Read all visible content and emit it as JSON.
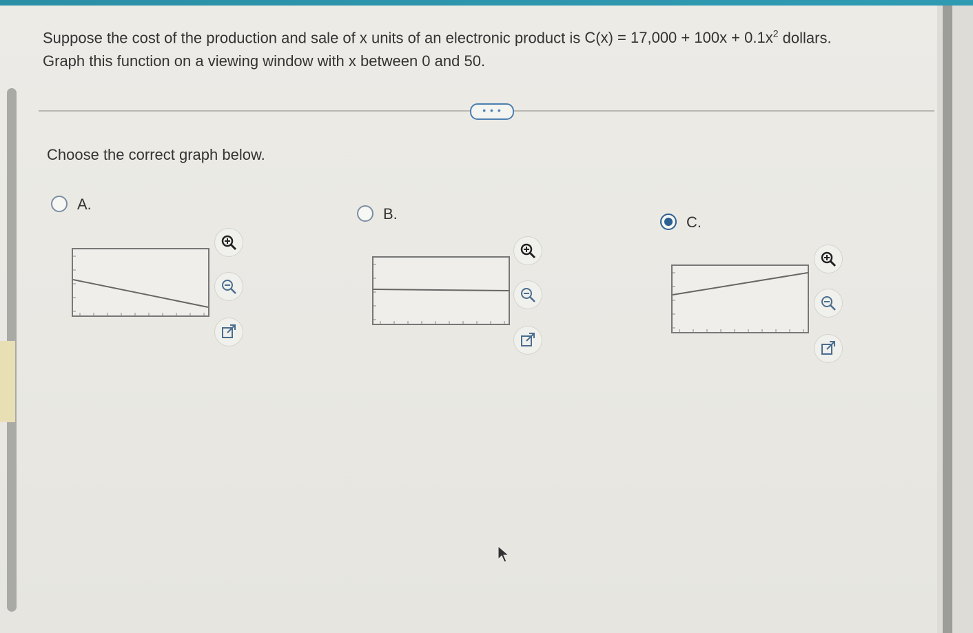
{
  "question": {
    "line1_text": "Suppose the cost of the production and sale of x units of an electronic product is",
    "formula_main": "C(x) = 17,000 + 100x + 0.1x",
    "formula_exponent": "2",
    "line1_suffix": "dollars.",
    "line2_text": "Graph this function on a viewing window with x between 0 and 50."
  },
  "more_button": "• • •",
  "prompt": "Choose the correct graph below.",
  "options": [
    {
      "label": "A.",
      "selected": false,
      "shape": "decreasing-line"
    },
    {
      "label": "B.",
      "selected": false,
      "shape": "horizontal-line"
    },
    {
      "label": "C.",
      "selected": true,
      "shape": "increasing-line"
    }
  ],
  "icons": {
    "zoom_in": "zoom-in-icon",
    "zoom_out": "zoom-out-icon",
    "open_new": "open-new-window-icon"
  },
  "colors": {
    "accent": "#2c5f92",
    "graph_line": "#666666",
    "top_strip": "#2b8fa6"
  }
}
